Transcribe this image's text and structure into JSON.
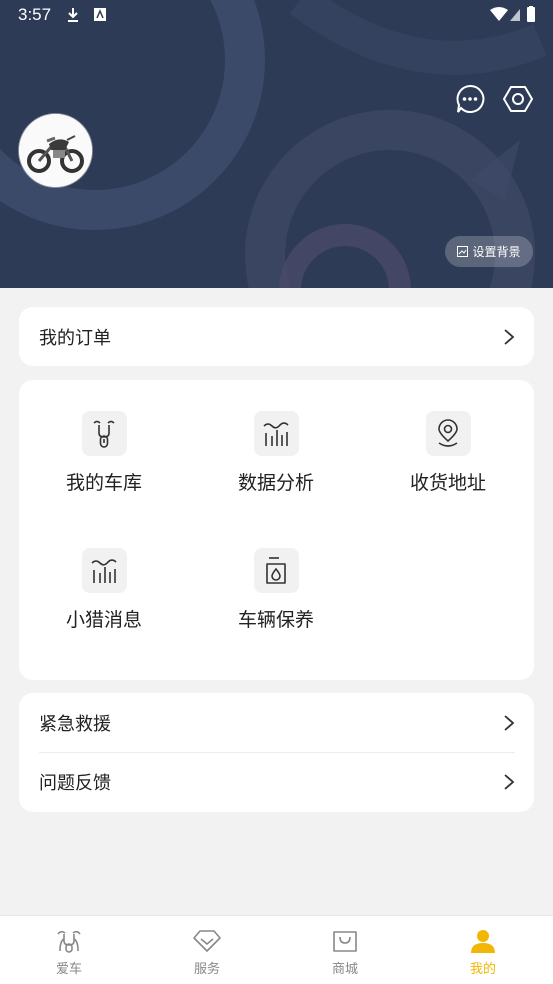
{
  "status_bar": {
    "time": "3:57"
  },
  "header": {
    "avatar_icon": "motorcycle-avatar",
    "message_icon": "chat-bubble-icon",
    "settings_icon": "hexagon-settings-icon",
    "set_background_label": "设置背景"
  },
  "order_card": {
    "label": "我的订单"
  },
  "grid": {
    "items": [
      {
        "label": "我的车库",
        "icon": "scooter-icon"
      },
      {
        "label": "数据分析",
        "icon": "chart-icon"
      },
      {
        "label": "收货地址",
        "icon": "location-icon"
      },
      {
        "label": "小猎消息",
        "icon": "chart-icon"
      },
      {
        "label": "车辆保养",
        "icon": "oil-can-icon"
      }
    ]
  },
  "service_card": {
    "rows": [
      {
        "label": "紧急救援"
      },
      {
        "label": "问题反馈"
      }
    ]
  },
  "tabbar": {
    "tabs": [
      {
        "label": "爱车",
        "icon": "scooter-icon"
      },
      {
        "label": "服务",
        "icon": "diamond-icon"
      },
      {
        "label": "商城",
        "icon": "shopping-bag-icon"
      },
      {
        "label": "我的",
        "icon": "person-icon"
      }
    ],
    "active_color": "#f2b705"
  }
}
